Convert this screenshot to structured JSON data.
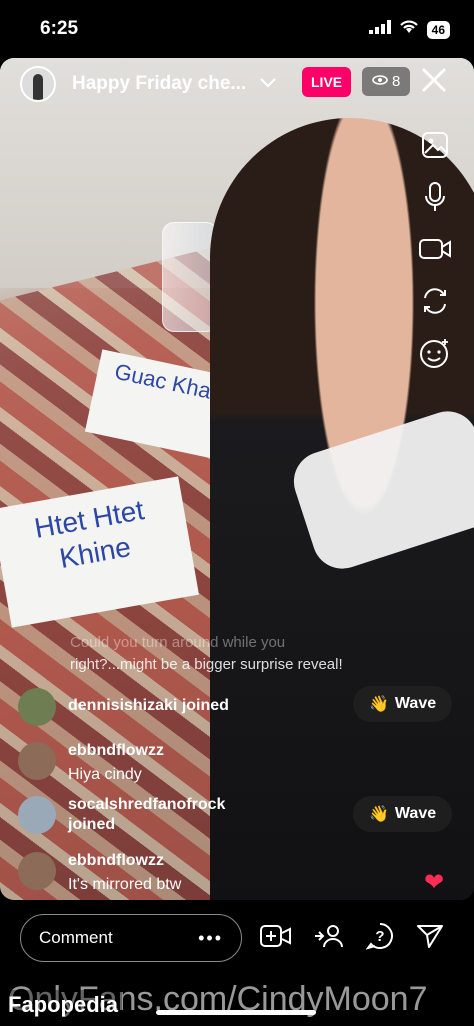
{
  "status_bar": {
    "time": "6:25",
    "battery": "46",
    "icons": [
      "signal-icon",
      "wifi-icon",
      "battery-icon"
    ]
  },
  "live_header": {
    "title": "Happy Friday che...",
    "live_badge": "LIVE",
    "viewer_count": "8",
    "icons": [
      "chevron-down-icon",
      "eye-icon",
      "close-icon"
    ]
  },
  "scene": {
    "sign_top": "Guac Khant",
    "sign_bottom_line1": "Htet Htet",
    "sign_bottom_line2": "Khine"
  },
  "side_rail": [
    "gallery-icon",
    "microphone-icon",
    "video-camera-icon",
    "flip-camera-icon",
    "face-effects-icon"
  ],
  "comments": [
    {
      "text_line1": "Could you turn around while you",
      "text_line2": "right?...might be a bigger surprise reveal!"
    },
    {
      "user": "dennisishizaki joined",
      "message": "",
      "wave": "Wave"
    },
    {
      "user": "ebbndflowzz",
      "message": "Hiya cindy"
    },
    {
      "user": "socalshredfanofrock",
      "message": "joined",
      "wave": "Wave"
    },
    {
      "user": "ebbndflowzz",
      "message": "It's mirrored btw"
    }
  ],
  "bottom_bar": {
    "comment_placeholder": "Comment",
    "more": "•••",
    "icons": [
      "add-guest-icon",
      "invite-icon",
      "question-icon",
      "share-icon"
    ]
  },
  "watermark": {
    "text": "OnlyFans.com/CindyMoon7",
    "brand": "Fapopedia"
  },
  "colors": {
    "live": "#ff0069",
    "heart": "#ff2d55",
    "background": "#000000"
  }
}
